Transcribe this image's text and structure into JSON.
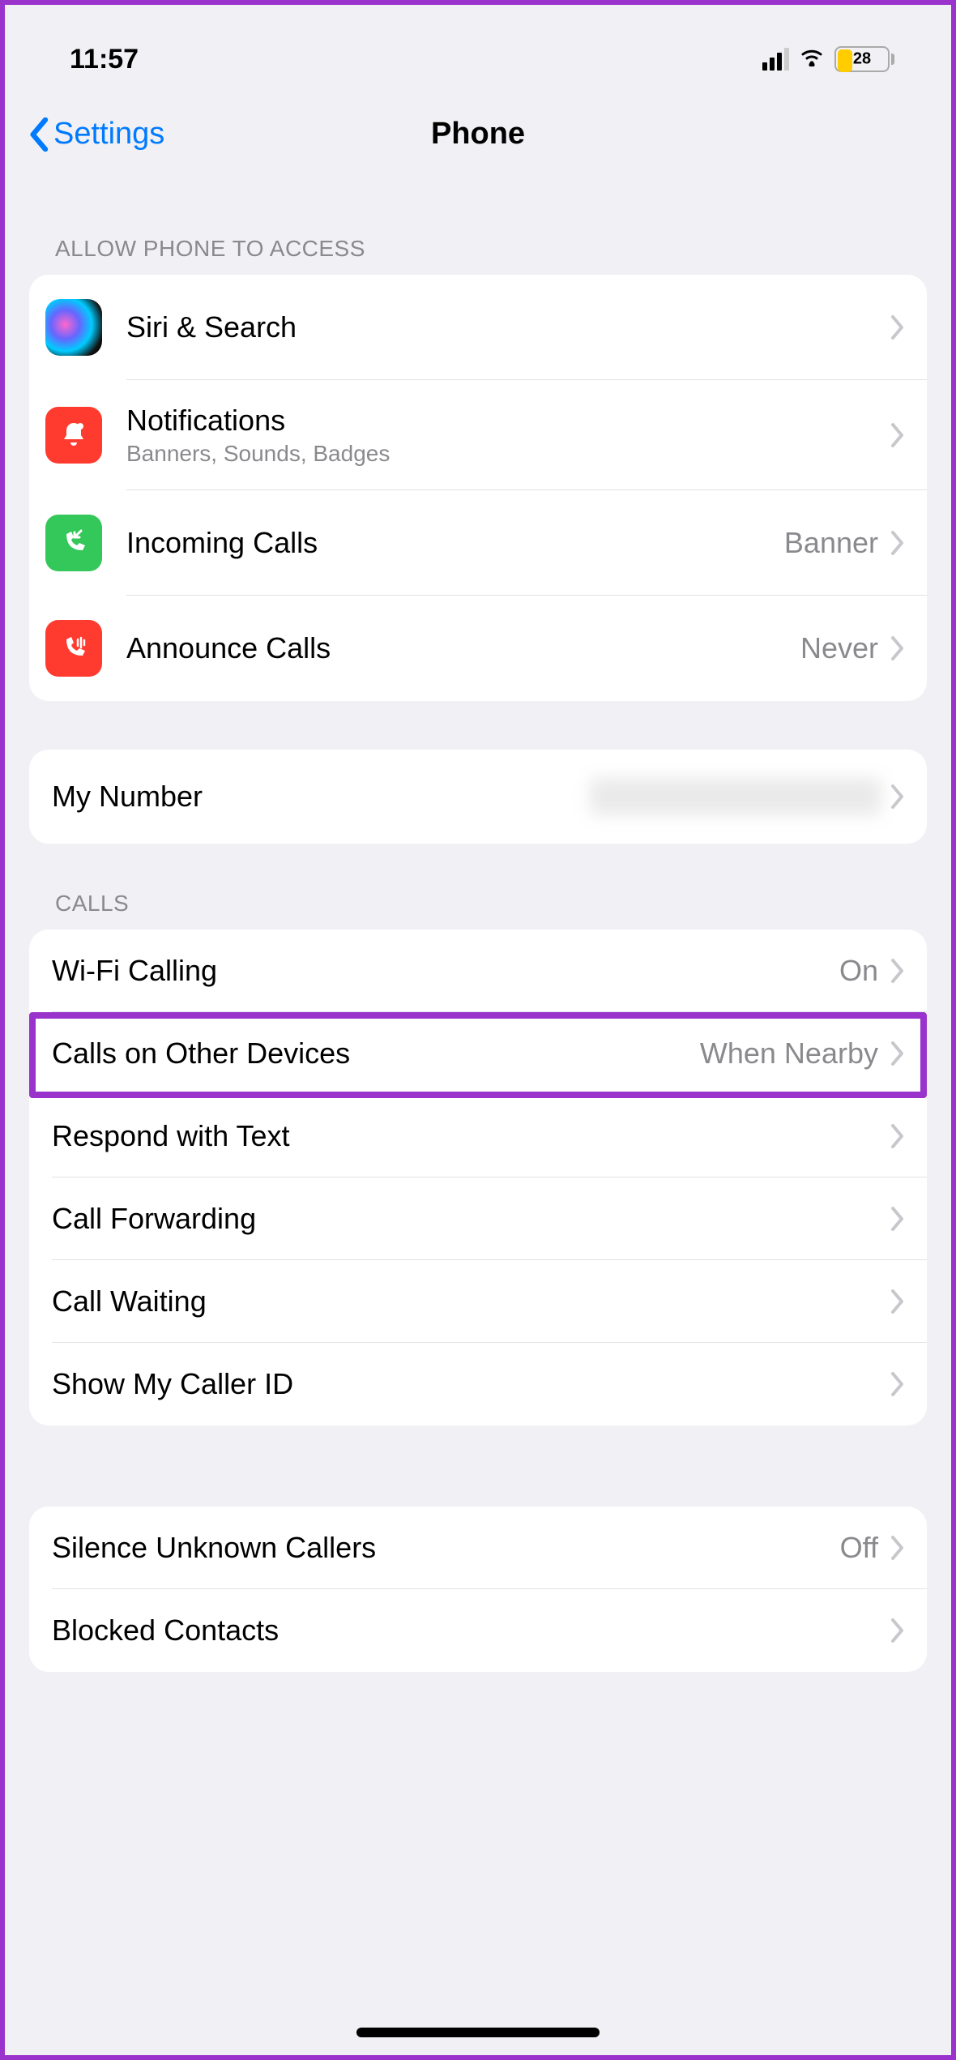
{
  "status": {
    "time": "11:57",
    "battery_pct": "28"
  },
  "nav": {
    "back_label": "Settings",
    "title": "Phone"
  },
  "sections": {
    "access_hdr": "ALLOW PHONE TO ACCESS",
    "calls_hdr": "CALLS"
  },
  "rows": {
    "siri": {
      "title": "Siri & Search"
    },
    "notifications": {
      "title": "Notifications",
      "sub": "Banners, Sounds, Badges"
    },
    "incoming": {
      "title": "Incoming Calls",
      "value": "Banner"
    },
    "announce": {
      "title": "Announce Calls",
      "value": "Never"
    },
    "mynumber": {
      "title": "My Number"
    },
    "wifi": {
      "title": "Wi-Fi Calling",
      "value": "On"
    },
    "otherdev": {
      "title": "Calls on Other Devices",
      "value": "When Nearby"
    },
    "respond": {
      "title": "Respond with Text"
    },
    "forward": {
      "title": "Call Forwarding"
    },
    "waiting": {
      "title": "Call Waiting"
    },
    "callerid": {
      "title": "Show My Caller ID"
    },
    "silence": {
      "title": "Silence Unknown Callers",
      "value": "Off"
    },
    "blocked": {
      "title": "Blocked Contacts"
    }
  }
}
